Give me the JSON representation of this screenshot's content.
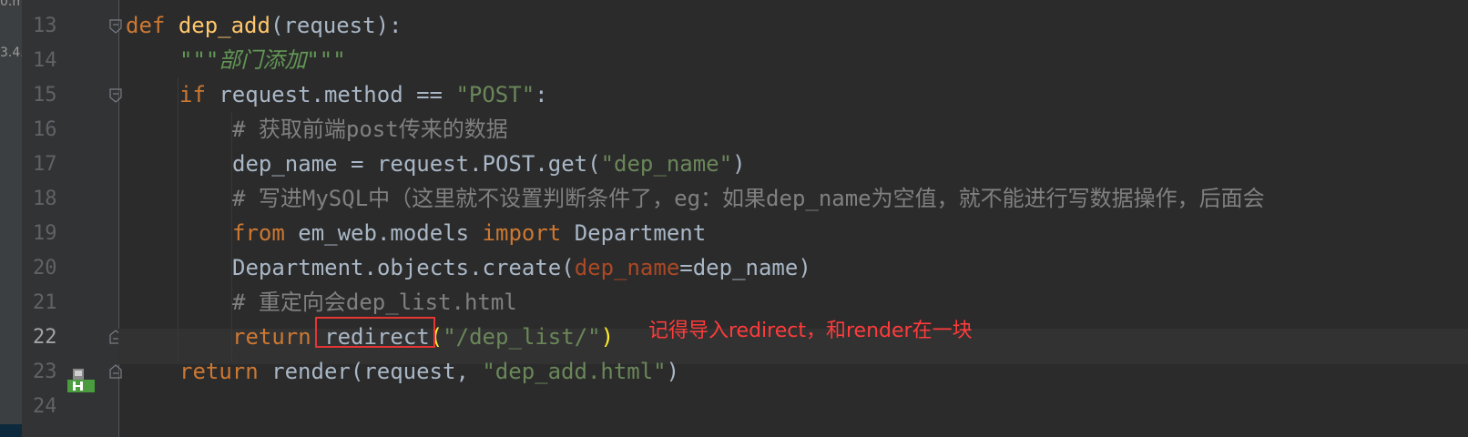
{
  "sidebar_fragments": [
    "0.m",
    "3.4."
  ],
  "line_numbers": [
    "13",
    "14",
    "15",
    "16",
    "17",
    "18",
    "19",
    "20",
    "21",
    "22",
    "23",
    "24"
  ],
  "current_line": "22",
  "code": {
    "l13": {
      "kw": "def",
      "sp": " ",
      "fn": "dep_add",
      "rest": "(request):"
    },
    "l14": {
      "doc": "\"\"\"部门添加\"\"\""
    },
    "l15": {
      "kw": "if",
      "mid": " request.method == ",
      "str": "\"POST\"",
      "end": ":"
    },
    "l16": {
      "cmt": "# 获取前端post传来的数据"
    },
    "l17": {
      "a": "dep_name = request.POST.get(",
      "str": "\"dep_name\"",
      "b": ")"
    },
    "l18": {
      "cmt": "# 写进MySQL中（这里就不设置判断条件了，eg：如果dep_name为空值，就不能进行写数据操作，后面会"
    },
    "l19": {
      "kw1": "from",
      "a": " em_web.models ",
      "kw2": "import",
      "b": " Department"
    },
    "l20": {
      "a": "Department.objects.create(",
      "param": "dep_name",
      "b": "=dep_name)"
    },
    "l21": {
      "cmt": "# 重定向会dep_list.html"
    },
    "l22": {
      "kw": "return",
      "sp": " ",
      "call": "redirect",
      "open": "(",
      "str": "\"/dep_list/\"",
      "close": ")"
    },
    "l23": {
      "kw": "return",
      "a": " render(request, ",
      "str": "\"dep_add.html\"",
      "b": ")"
    }
  },
  "annotation_text": "记得导入redirect，和render在一块",
  "colors": {
    "background": "#2b2b2b",
    "keyword": "#cc7832",
    "function": "#ffc66d",
    "string": "#6a8759",
    "comment": "#808080",
    "param": "#aa4926",
    "annotation": "#ff3b3b",
    "highlight_box": "#e53535"
  }
}
